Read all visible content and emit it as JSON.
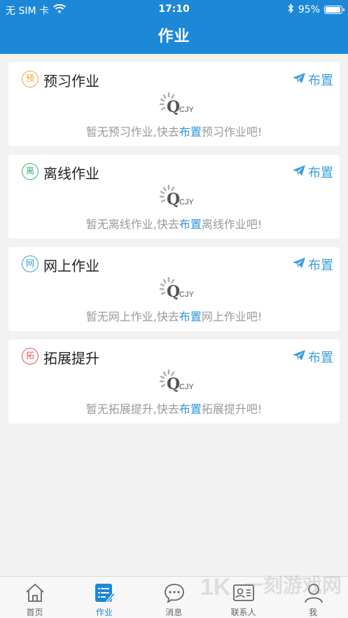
{
  "status_bar": {
    "carrier": "无 SIM 卡",
    "time": "17:10",
    "battery_percent": "95%",
    "battery_level": 0.95
  },
  "header": {
    "title": "作业"
  },
  "cards": [
    {
      "badge": "预",
      "badge_color": "#f0a33a",
      "title": "预习作业",
      "assign_label": "布置",
      "msg_prefix": "暂无预习作业,快去",
      "msg_link": "布置",
      "msg_suffix": "预习作业吧!"
    },
    {
      "badge": "离",
      "badge_color": "#37b779",
      "title": "离线作业",
      "assign_label": "布置",
      "msg_prefix": "暂无离线作业,快去",
      "msg_link": "布置",
      "msg_suffix": "离线作业吧!"
    },
    {
      "badge": "网",
      "badge_color": "#3a9fdc",
      "title": "网上作业",
      "assign_label": "布置",
      "msg_prefix": "暂无网上作业,快去",
      "msg_link": "布置",
      "msg_suffix": "网上作业吧!"
    },
    {
      "badge": "拓",
      "badge_color": "#e2555a",
      "title": "拓展提升",
      "assign_label": "布置",
      "msg_prefix": "暂无拓展提升,快去",
      "msg_link": "布置",
      "msg_suffix": "拓展提升吧!"
    }
  ],
  "logo_text": "CJY",
  "tabs": [
    {
      "label": "首页",
      "icon": "home-icon",
      "active": false
    },
    {
      "label": "作业",
      "icon": "homework-icon",
      "active": true
    },
    {
      "label": "消息",
      "icon": "message-icon",
      "active": false
    },
    {
      "label": "联系人",
      "icon": "contacts-icon",
      "active": false
    },
    {
      "label": "我",
      "icon": "profile-icon",
      "active": false
    }
  ],
  "watermark": "一刻游戏网",
  "colors": {
    "header": "#1e88d8",
    "accent": "#3a9fdc"
  }
}
